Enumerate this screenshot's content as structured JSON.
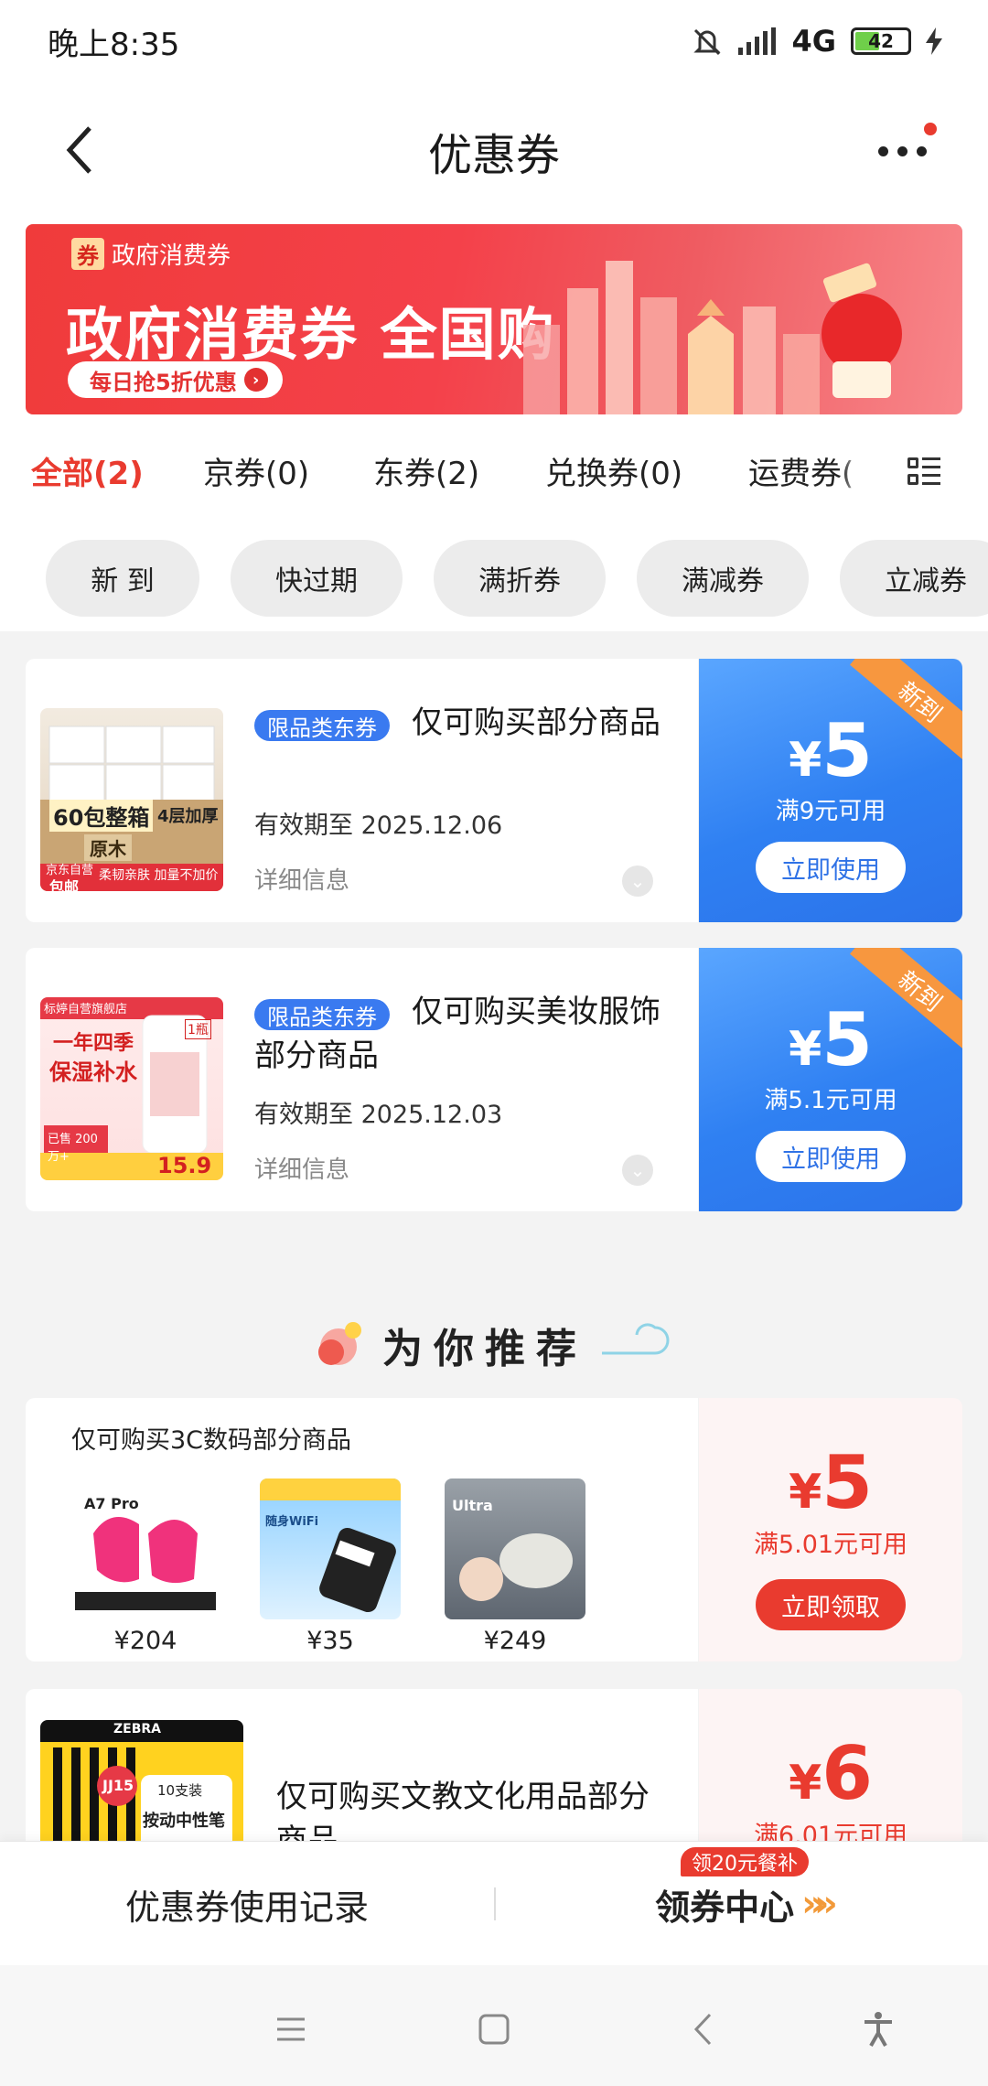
{
  "status_bar": {
    "time": "晚上8:35",
    "network": "4G",
    "battery": "42"
  },
  "header": {
    "title": "优惠券"
  },
  "banner": {
    "tag_icon": "券",
    "tag_label": "政府消费券",
    "headline": "政府消费券 全国购",
    "cta": "每日抢5折优惠"
  },
  "tabs": [
    {
      "label": "全部(2)"
    },
    {
      "label": "京券(0)"
    },
    {
      "label": "东券(2)"
    },
    {
      "label": "兑换券(0)"
    },
    {
      "label": "运费券("
    }
  ],
  "chips": [
    {
      "label": "新 到"
    },
    {
      "label": "快过期"
    },
    {
      "label": "满折券"
    },
    {
      "label": "满减券"
    },
    {
      "label": "立减券"
    }
  ],
  "coupons": [
    {
      "tag": "限品类东券",
      "description": "仅可购买部分商品",
      "expiry": "有效期至 2025.12.06",
      "detail": "详细信息",
      "ribbon": "新到",
      "currency": "¥",
      "amount": "5",
      "condition": "满9元可用",
      "button": "立即使用",
      "thumb_text_1": "60包整箱",
      "thumb_text_2": "4层加厚",
      "thumb_text_3": "原木",
      "thumb_text_4": "柔韧亲肤 加量不加价",
      "thumb_text_5": "京东自营",
      "thumb_text_6": "包邮"
    },
    {
      "tag": "限品类东券",
      "description": "仅可购买美妆服饰部分商品",
      "expiry": "有效期至 2025.12.03",
      "detail": "详细信息",
      "ribbon": "新到",
      "currency": "¥",
      "amount": "5",
      "condition": "满5.1元可用",
      "button": "立即使用",
      "thumb_text_1": "标婷自营旗舰店",
      "thumb_text_2": "一年四季",
      "thumb_text_3": "保湿补水",
      "thumb_text_4": "已售 200万+",
      "thumb_text_5": "15.9",
      "thumb_text_6": "1瓶"
    }
  ],
  "recommend": {
    "title": "为你推荐",
    "cards": [
      {
        "description": "仅可购买3C数码部分商品",
        "products": [
          {
            "price": "¥204",
            "label": "A7 Pro"
          },
          {
            "price": "¥35",
            "label": "随身WiFi"
          },
          {
            "price": "¥249",
            "label": "Ultra"
          }
        ],
        "currency": "¥",
        "amount": "5",
        "condition": "满5.01元可用",
        "button": "立即领取"
      },
      {
        "description": "仅可购买文教文化用品部分商品",
        "thumb_text_1": "ZEBRA",
        "thumb_text_2": "JJ15",
        "thumb_text_3": "10支装",
        "thumb_text_4": "按动中性笔",
        "currency": "¥",
        "amount": "6",
        "condition": "满6.01元可用"
      }
    ]
  },
  "bottom_bar": {
    "records": "优惠券使用记录",
    "center": "领券中心",
    "badge": "领20元餐补"
  },
  "colors": {
    "accent_red": "#e93b2f",
    "coupon_blue": "#2f80f2",
    "ribbon_orange": "#f7973f",
    "tag_blue": "#3a7af0"
  }
}
